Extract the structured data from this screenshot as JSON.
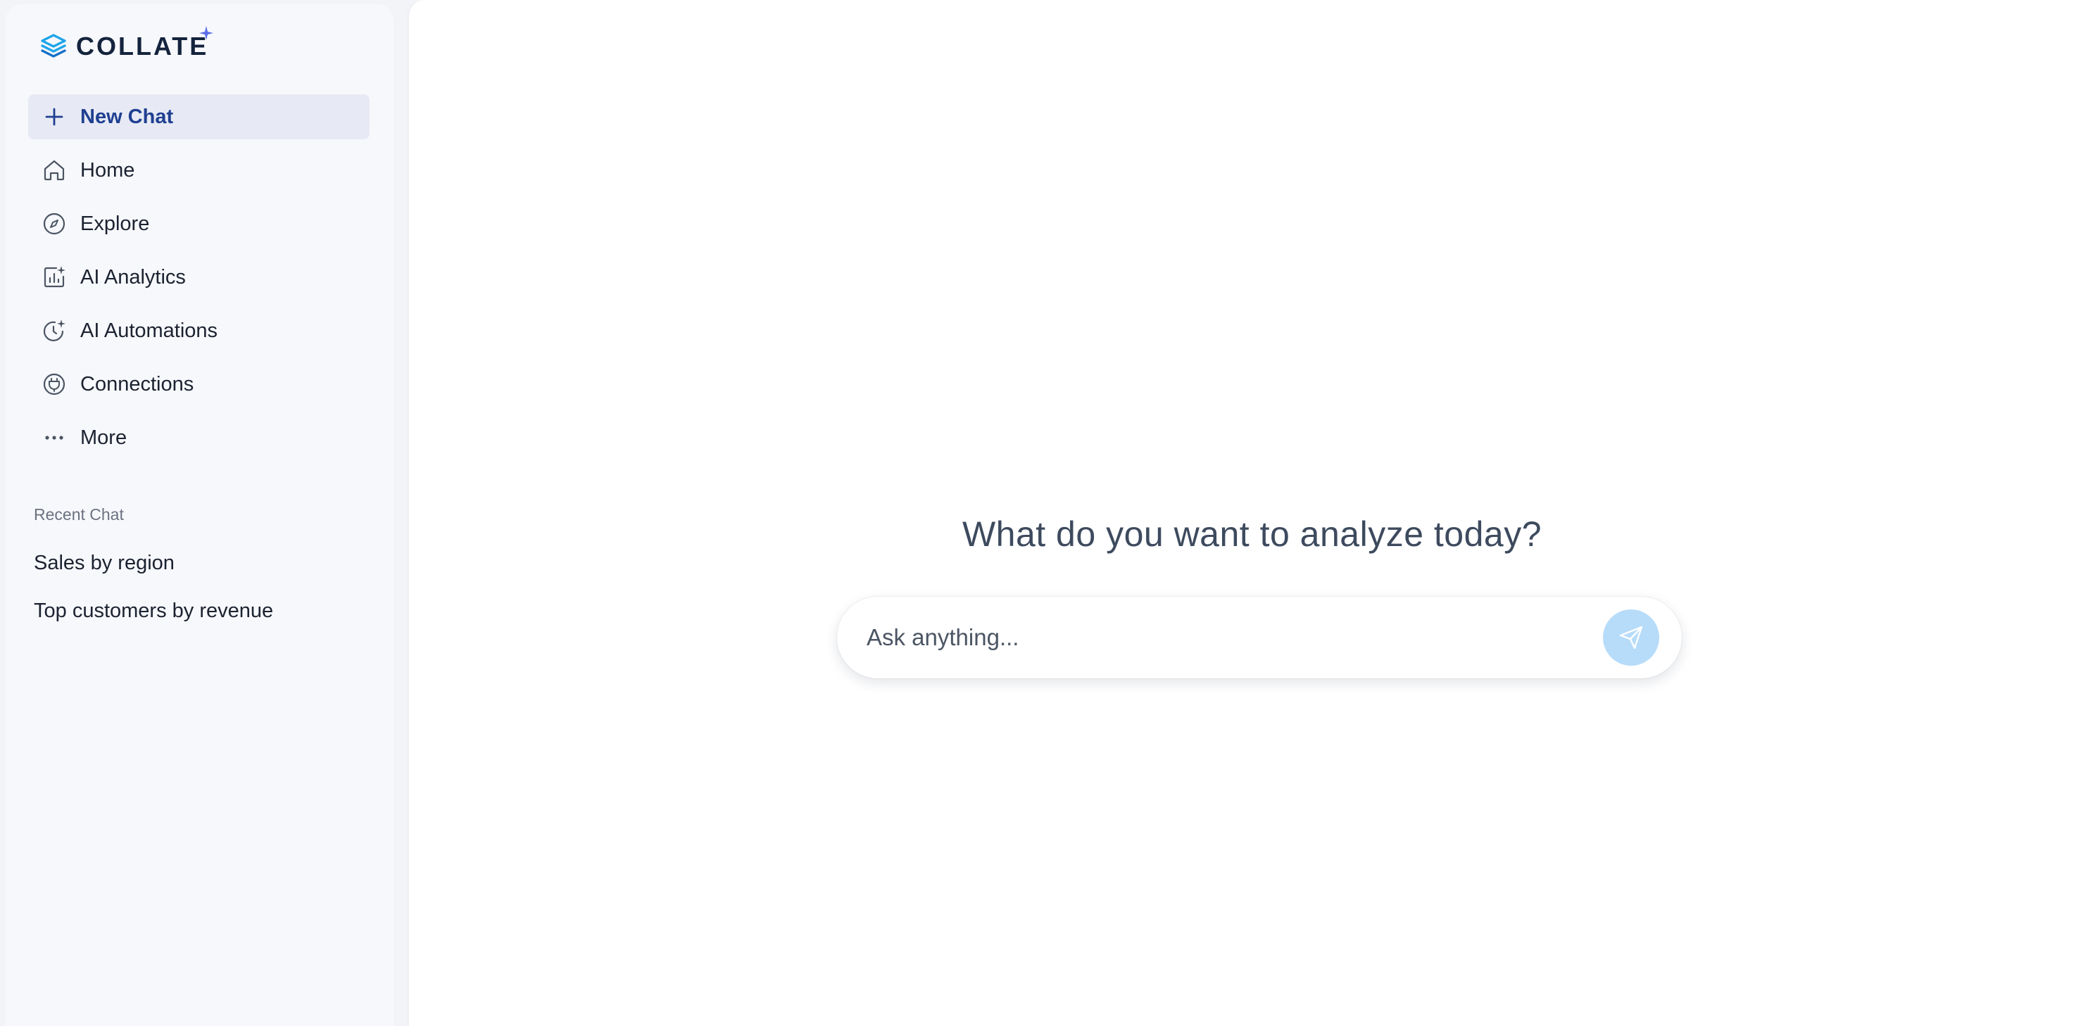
{
  "brand": {
    "name": "COLLATE",
    "logo_icon": "collate-layers-logo",
    "accent": "#1fa5e8",
    "spark_color": "#5b6ee8"
  },
  "sidebar": {
    "items": [
      {
        "label": "New Chat",
        "icon": "plus-icon",
        "active": true
      },
      {
        "label": "Home",
        "icon": "home-icon"
      },
      {
        "label": "Explore",
        "icon": "compass-icon"
      },
      {
        "label": "AI Analytics",
        "icon": "analytics-sparkle-icon"
      },
      {
        "label": "AI Automations",
        "icon": "automation-clock-icon"
      },
      {
        "label": "Connections",
        "icon": "plug-icon"
      },
      {
        "label": "More",
        "icon": "ellipsis-icon"
      }
    ],
    "recent_title": "Recent Chat",
    "recent": [
      {
        "label": "Sales by region"
      },
      {
        "label": "Top customers by revenue"
      }
    ]
  },
  "main": {
    "headline": "What do you want to analyze today?",
    "input": {
      "placeholder": "Ask anything...",
      "value": ""
    },
    "send_icon": "send-icon",
    "send_button_color": "#b7dcfa"
  }
}
